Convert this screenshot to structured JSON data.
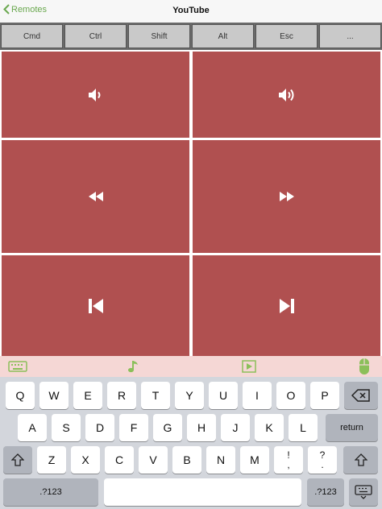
{
  "header": {
    "back_label": "Remotes",
    "title": "YouTube"
  },
  "modifiers": [
    "Cmd",
    "Ctrl",
    "Shift",
    "Alt",
    "Esc",
    "..."
  ],
  "controls": [
    {
      "name": "volume-down",
      "icon": "volume-low-icon"
    },
    {
      "name": "volume-up",
      "icon": "volume-high-icon"
    },
    {
      "name": "rewind",
      "icon": "rewind-icon"
    },
    {
      "name": "fast-forward",
      "icon": "fast-forward-icon"
    },
    {
      "name": "previous",
      "icon": "skip-previous-icon"
    },
    {
      "name": "next",
      "icon": "skip-next-icon"
    }
  ],
  "toolbar_icons": [
    "keyboard-icon",
    "music-note-icon",
    "play-box-icon",
    "mouse-icon"
  ],
  "keyboard": {
    "row1": [
      "Q",
      "W",
      "E",
      "R",
      "T",
      "Y",
      "U",
      "I",
      "O",
      "P"
    ],
    "row2": [
      "A",
      "S",
      "D",
      "F",
      "G",
      "H",
      "J",
      "K",
      "L"
    ],
    "row3": [
      "Z",
      "X",
      "C",
      "V",
      "B",
      "N",
      "M"
    ],
    "punct1": [
      "!",
      ","
    ],
    "punct2": [
      "?",
      "."
    ],
    "return_label": "return",
    "numbers_label": ".?123"
  },
  "colors": {
    "accent": "#6aa84f",
    "button": "#b05050",
    "toolbar": "#f5d7d5"
  }
}
